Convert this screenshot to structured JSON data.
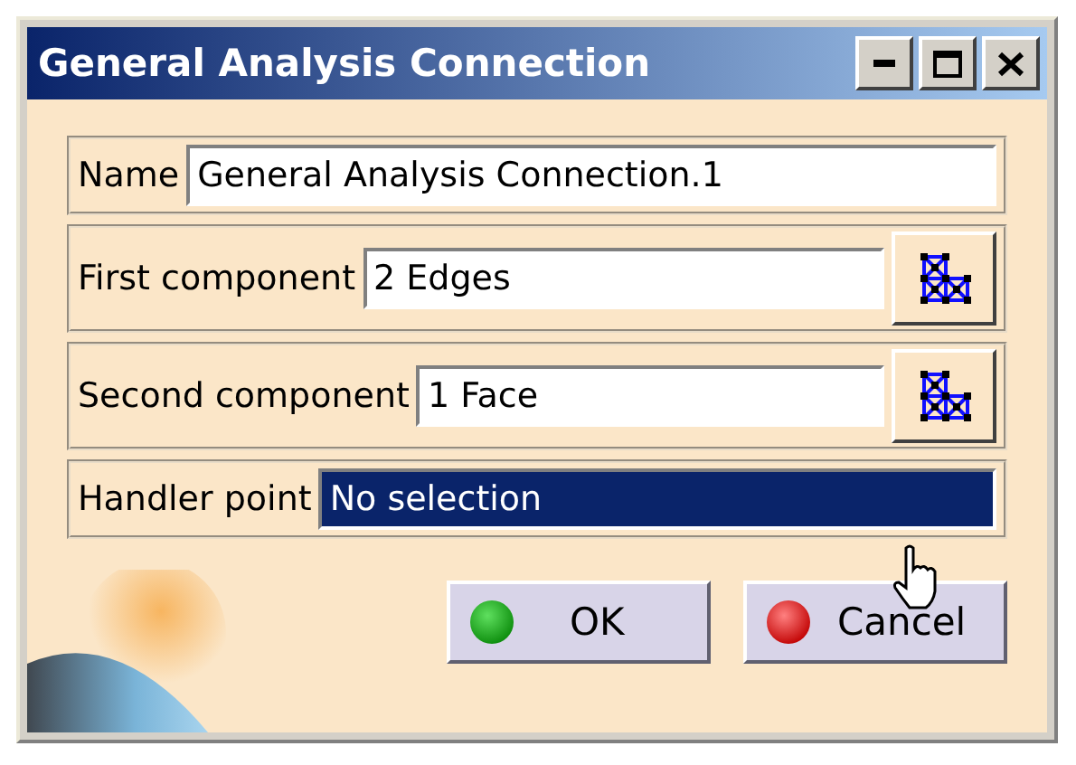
{
  "window": {
    "title": "General Analysis Connection"
  },
  "title_buttons": [
    {
      "kind": "minimize"
    },
    {
      "kind": "maximize"
    },
    {
      "kind": "close"
    }
  ],
  "fields": [
    {
      "kind": "text",
      "label": "Name",
      "value": "General Analysis Connection.1",
      "selected": false
    },
    {
      "kind": "picker",
      "label": "First component",
      "value": "2 Edges",
      "selected": false
    },
    {
      "kind": "picker",
      "label": "Second component",
      "value": "1 Face",
      "selected": false
    },
    {
      "kind": "text",
      "label": "Handler point",
      "value": "No selection",
      "selected": true
    }
  ],
  "buttons": [
    {
      "kind": "ok",
      "label": "OK"
    },
    {
      "kind": "cancel",
      "label": "Cancel"
    }
  ]
}
